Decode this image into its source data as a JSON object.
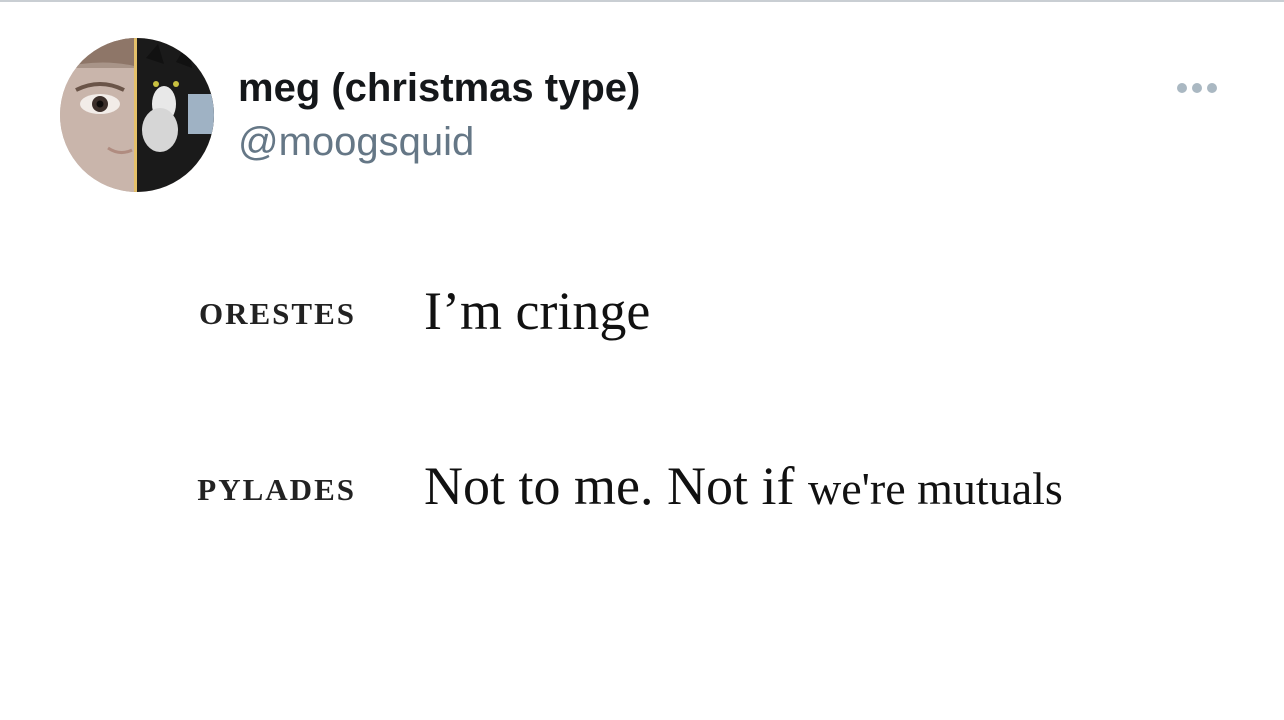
{
  "tweet": {
    "display_name": "meg (christmas type)",
    "handle": "@moogsquid",
    "avatar_icon": "profile-avatar",
    "more_icon": "more-horizontal-icon"
  },
  "dialogue": [
    {
      "speaker": "ORESTES",
      "line": "I’m cringe",
      "line_tail": ""
    },
    {
      "speaker": "PYLADES",
      "line": "Not to me. Not if ",
      "line_tail": "we're mutuals"
    }
  ],
  "colors": {
    "name": "#14171a",
    "handle": "#657786",
    "more_dots": "#aab8c2",
    "border": "#c9ced3"
  }
}
